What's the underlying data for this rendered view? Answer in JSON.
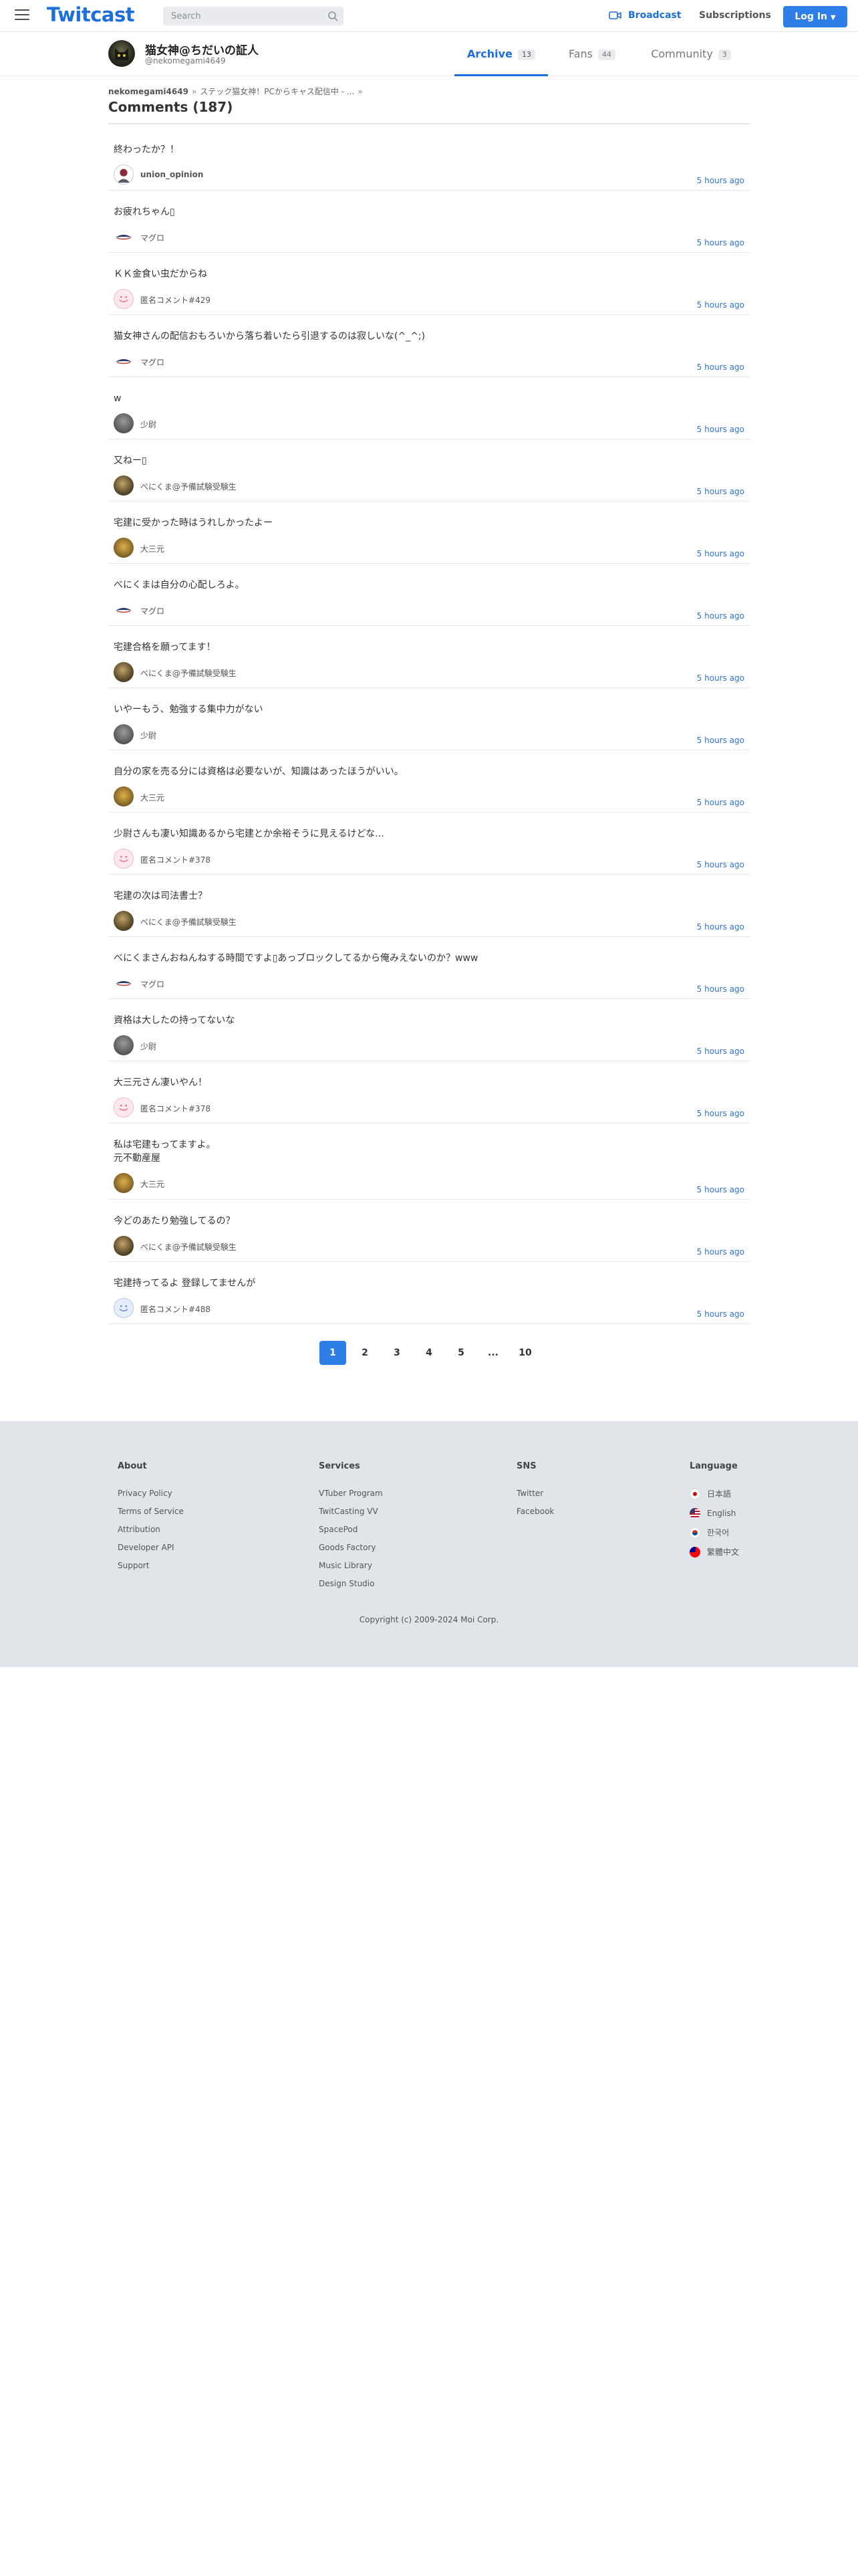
{
  "header": {
    "logo": "Twitcast",
    "search_placeholder": "Search",
    "broadcast_label": "Broadcast",
    "subscriptions_label": "Subscriptions",
    "login_label": "Log In"
  },
  "user": {
    "name": "猫女神@ちだいの証人",
    "id": "@nekomegami4649"
  },
  "tabs": [
    {
      "label": "Archive",
      "count": "13"
    },
    {
      "label": "Fans",
      "count": "44"
    },
    {
      "label": "Community",
      "count": "3"
    }
  ],
  "breadcrumb": {
    "user": "nekomegami4649",
    "movie": "ステック猫女神！PCからキャス配信中 - ..."
  },
  "page_title": "Comments (187)",
  "comments": [
    {
      "text": "終わったか？！",
      "author": "union_opinion",
      "time": "5 hours ago"
    },
    {
      "text": "お疲れちゃん▯",
      "author": "マグロ",
      "time": "5 hours ago"
    },
    {
      "text": "ＫＫ金食い虫だからね",
      "author": "匿名コメント#429",
      "time": "5 hours ago"
    },
    {
      "text": "猫女神さんの配信おもろいから落ち着いたら引退するのは寂しいな(^_^;)",
      "author": "マグロ",
      "time": "5 hours ago"
    },
    {
      "text": "w",
      "author": "少尉",
      "time": "5 hours ago"
    },
    {
      "text": "又ねー▯",
      "author": "べにくま@予備試験受験生",
      "time": "5 hours ago"
    },
    {
      "text": "宅建に受かった時はうれしかったよー",
      "author": "大三元",
      "time": "5 hours ago"
    },
    {
      "text": "べにくまは自分の心配しろよ。",
      "author": "マグロ",
      "time": "5 hours ago"
    },
    {
      "text": "宅建合格を願ってます！",
      "author": "べにくま@予備試験受験生",
      "time": "5 hours ago"
    },
    {
      "text": "いやーもう、勉強する集中力がない",
      "author": "少尉",
      "time": "5 hours ago"
    },
    {
      "text": "自分の家を売る分には資格は必要ないが、知識はあったほうがいい。",
      "author": "大三元",
      "time": "5 hours ago"
    },
    {
      "text": "少尉さんも凄い知識あるから宅建とか余裕そうに見えるけどな...",
      "author": "匿名コメント#378",
      "time": "5 hours ago"
    },
    {
      "text": "宅建の次は司法書士？",
      "author": "べにくま@予備試験受験生",
      "time": "5 hours ago"
    },
    {
      "text": "べにくまさんおねんねする時間ですよ▯あっブロックしてるから俺みえないのか？www",
      "author": "マグロ",
      "time": "5 hours ago"
    },
    {
      "text": "資格は大したの持ってないな",
      "author": "少尉",
      "time": "5 hours ago"
    },
    {
      "text": "大三元さん凄いやん！",
      "author": "匿名コメント#378",
      "time": "5 hours ago"
    },
    {
      "text": "私は宅建もってますよ。\n元不動産屋",
      "author": "大三元",
      "time": "5 hours ago"
    },
    {
      "text": "今どのあたり勉強してるの？",
      "author": "べにくま@予備試験受験生",
      "time": "5 hours ago"
    },
    {
      "text": "宅建持ってるよ 登録してませんが",
      "author": "匿名コメント#488",
      "time": "5 hours ago"
    }
  ],
  "pagination": [
    "1",
    "2",
    "3",
    "4",
    "5",
    "...",
    "10"
  ],
  "footer": {
    "about": {
      "heading": "About",
      "links": [
        "Privacy Policy",
        "Terms of Service",
        "Attribution",
        "Developer API",
        "Support"
      ]
    },
    "services": {
      "heading": "Services",
      "links": [
        "VTuber Program",
        "TwitCasting VV",
        "SpacePod",
        "Goods Factory",
        "Music Library",
        "Design Studio"
      ]
    },
    "sns": {
      "heading": "SNS",
      "links": [
        "Twitter",
        "Facebook"
      ]
    },
    "language": {
      "heading": "Language",
      "links": [
        "日本語",
        "English",
        "한국어",
        "繁體中文"
      ]
    },
    "copyright": "Copyright (c) 2009-2024 Moi Corp."
  }
}
